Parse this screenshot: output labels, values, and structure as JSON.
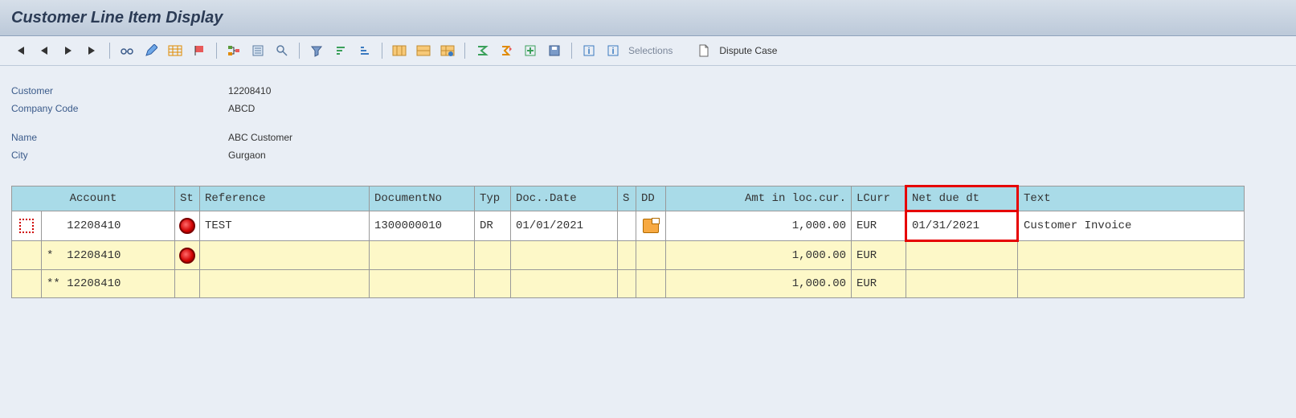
{
  "title": "Customer Line Item Display",
  "toolbar": {
    "selections_label": "Selections",
    "dispute_label": "Dispute Case"
  },
  "info": {
    "customer_label": "Customer",
    "customer_value": "12208410",
    "company_code_label": "Company Code",
    "company_code_value": "ABCD",
    "name_label": "Name",
    "name_value": "ABC Customer",
    "city_label": "City",
    "city_value": "Gurgaon"
  },
  "columns": {
    "account": "Account",
    "st": "St",
    "reference": "Reference",
    "documentno": "DocumentNo",
    "typ": "Typ",
    "docdate": "Doc..Date",
    "s": "S",
    "dd": "DD",
    "amt": "Amt in loc.cur.",
    "lcurr": "LCurr",
    "netdue": "Net due dt",
    "text": "Text"
  },
  "rows": [
    {
      "prefix": "   ",
      "account": "12208410",
      "status": "open",
      "reference": "TEST",
      "documentno": "1300000010",
      "typ": "DR",
      "docdate": "01/01/2021",
      "s": "",
      "dd": "icon",
      "amt": "1,000.00",
      "lcurr": "EUR",
      "netdue": "01/31/2021",
      "text": "Customer Invoice",
      "style": "white",
      "sel": true
    },
    {
      "prefix": "*  ",
      "account": "12208410",
      "status": "open",
      "reference": "",
      "documentno": "",
      "typ": "",
      "docdate": "",
      "s": "",
      "dd": "",
      "amt": "1,000.00",
      "lcurr": "EUR",
      "netdue": "",
      "text": "",
      "style": "yell",
      "sel": false
    },
    {
      "prefix": "** ",
      "account": "12208410",
      "status": "",
      "reference": "",
      "documentno": "",
      "typ": "",
      "docdate": "",
      "s": "",
      "dd": "",
      "amt": "1,000.00",
      "lcurr": "EUR",
      "netdue": "",
      "text": "",
      "style": "yell",
      "sel": false
    }
  ]
}
